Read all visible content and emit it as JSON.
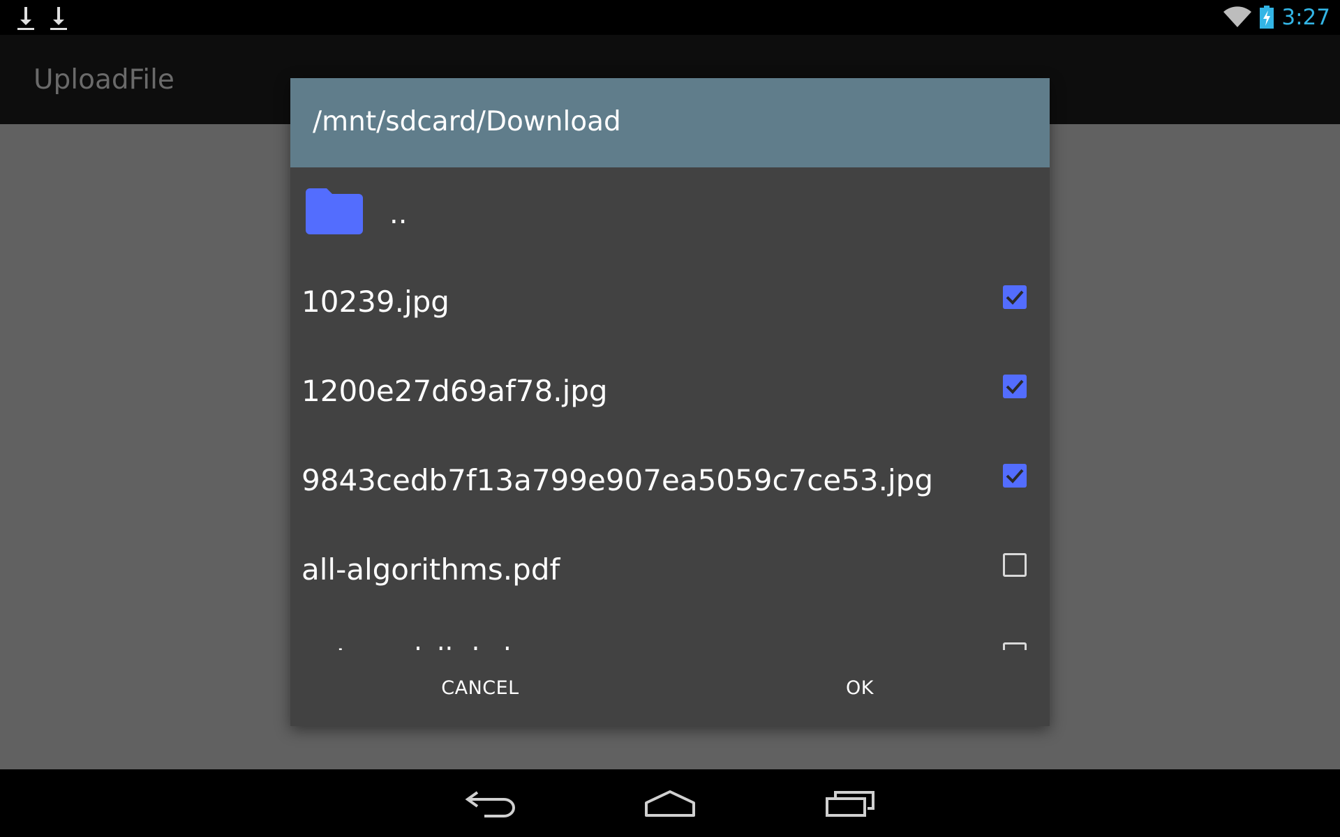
{
  "status_bar": {
    "notifications": [
      "download-icon",
      "download-icon"
    ],
    "wifi_icon": "wifi-icon",
    "battery_icon": "battery-charging-icon",
    "clock": "3:27",
    "clock_color": "#33b5e5"
  },
  "app_bar": {
    "title": "UploadFile"
  },
  "dialog": {
    "path": "/mnt/sdcard/Download",
    "header_color": "#607d8b",
    "parent_entry": {
      "icon": "folder-icon",
      "label": ".."
    },
    "files": [
      {
        "name": "10239.jpg",
        "checked": true
      },
      {
        "name": "1200e27d69af78.jpg",
        "checked": true
      },
      {
        "name": "9843cedb7f13a799e907ea5059c7ce53.jpg",
        "checked": true
      },
      {
        "name": "all-algorithms.pdf",
        "checked": false
      },
      {
        "name": "external_link_bumper.png",
        "checked": false
      }
    ],
    "accent_color": "#536dfe",
    "cancel_label": "CANCEL",
    "ok_label": "OK"
  },
  "nav_bar": {
    "icons": [
      "back-icon",
      "home-icon",
      "recents-icon"
    ]
  }
}
